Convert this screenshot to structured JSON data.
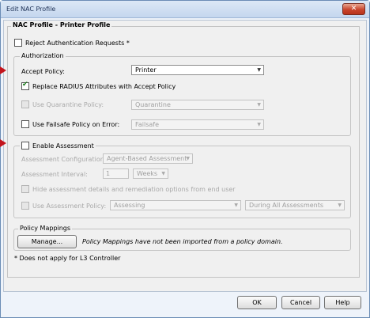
{
  "window": {
    "title": "Edit NAC Profile",
    "close_label": "✕"
  },
  "profile": {
    "title": "NAC Profile - Printer Profile",
    "reject_label": "Reject Authentication Requests *",
    "footnote": "* Does not apply for L3 Controller"
  },
  "authorization": {
    "legend": "Authorization",
    "accept_policy_label": "Accept Policy:",
    "accept_policy_value": "Printer",
    "replace_radius_label": "Replace RADIUS Attributes with Accept Policy",
    "replace_radius_checked": true,
    "quarantine_label": "Use Quarantine Policy:",
    "quarantine_value": "Quarantine",
    "failsafe_label": "Use Failsafe Policy on Error:",
    "failsafe_value": "Failsafe"
  },
  "assessment": {
    "enable_label": "Enable Assessment",
    "config_label": "Assessment Configuration:",
    "config_value": "Agent-Based Assessment",
    "interval_label": "Assessment Interval:",
    "interval_value": "1",
    "interval_unit": "Weeks",
    "hide_label": "Hide assessment details and remediation options from end user",
    "policy_label": "Use Assessment Policy:",
    "policy_value": "Assessing",
    "policy_scope": "During All Assessments"
  },
  "policy_mappings": {
    "legend": "Policy Mappings",
    "manage_label": "Manage...",
    "message": "Policy Mappings have not been imported from a policy domain."
  },
  "footer": {
    "ok_label": "OK",
    "cancel_label": "Cancel",
    "help_label": "Help"
  },
  "colors": {
    "marker": "#c3141c",
    "check": "#1a7a1a",
    "close": "#c8442c"
  }
}
